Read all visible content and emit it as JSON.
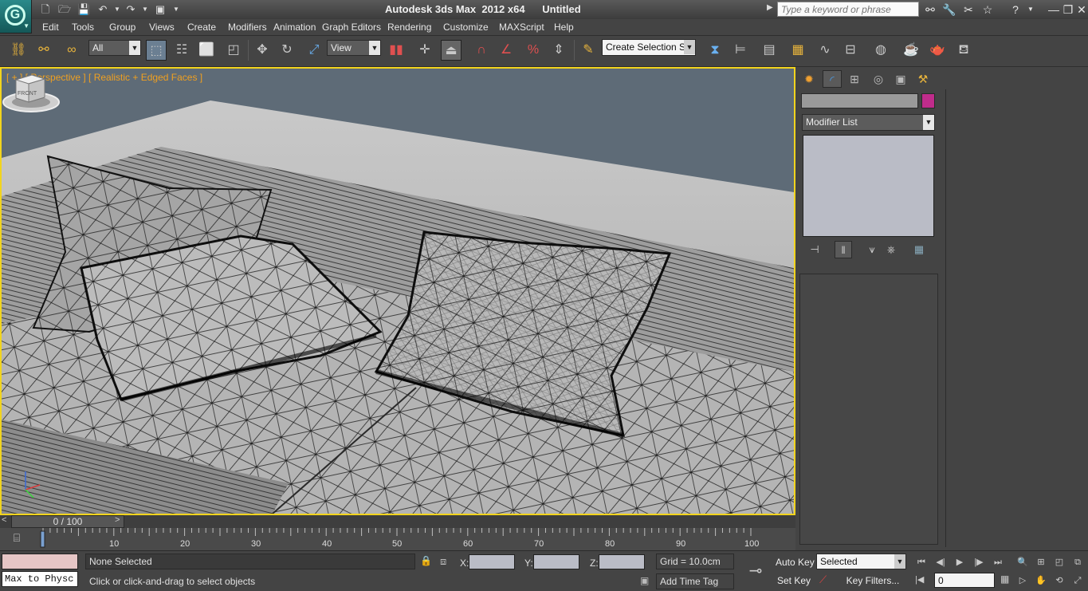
{
  "window": {
    "title": "Autodesk 3ds Max  2012 x64      Untitled"
  },
  "search": {
    "placeholder": "Type a keyword or phrase"
  },
  "menu": [
    "Edit",
    "Tools",
    "Group",
    "Views",
    "Create",
    "Modifiers",
    "Animation",
    "Graph Editors",
    "Rendering",
    "Customize",
    "MAXScript",
    "Help"
  ],
  "toolbar": {
    "selection_filter": "All",
    "reference_coord": "View",
    "named_selection": "Create Selection Se"
  },
  "viewport": {
    "label": "[ + ] [ Perspective ] [ Realistic + Edged Faces ]",
    "viewcube_face": "FRONT"
  },
  "command_panel": {
    "modifier_list": "Modifier List",
    "object_color": "#c02c8b"
  },
  "timeline": {
    "frame_display": "0 / 100",
    "ruler_labels": [
      "10",
      "20",
      "30",
      "40",
      "50",
      "60",
      "70",
      "80",
      "90",
      "100"
    ]
  },
  "status": {
    "listener_text": "Max to Physc",
    "selection_status": "None Selected",
    "prompt": "Click or click-and-drag to select objects",
    "x_label": "X:",
    "y_label": "Y:",
    "z_label": "Z:",
    "grid": "Grid = 10.0cm",
    "add_time_tag": "Add Time Tag",
    "auto_key": "Auto Key",
    "set_key": "Set Key",
    "key_mode": "Selected",
    "key_filters": "Key Filters...",
    "current_frame": "0"
  }
}
